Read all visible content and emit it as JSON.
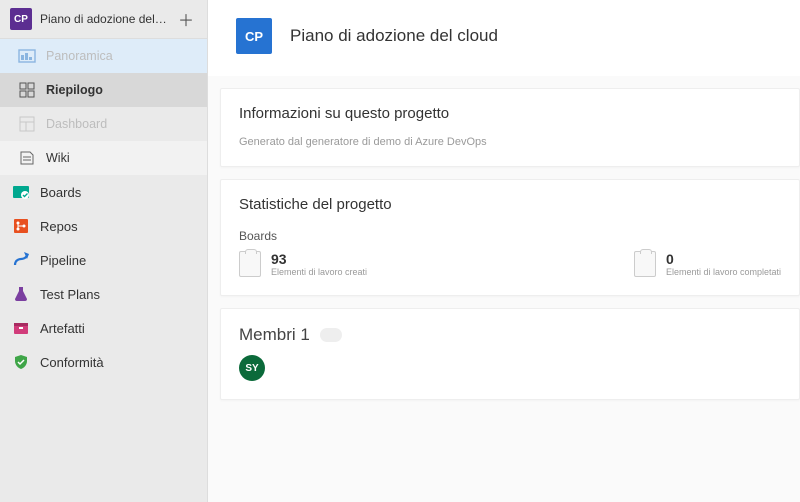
{
  "sidebar": {
    "project_badge": "CP",
    "project_name": "Piano di adozione del cloud",
    "items": [
      {
        "label": "Panoramica"
      },
      {
        "label": "Riepilogo"
      },
      {
        "label": "Dashboard"
      },
      {
        "label": "Wiki"
      },
      {
        "label": "Boards"
      },
      {
        "label": "Repos"
      },
      {
        "label": "Pipeline"
      },
      {
        "label": "Test Plans"
      },
      {
        "label": "Artefatti"
      },
      {
        "label": "Conformità"
      }
    ]
  },
  "header": {
    "badge": "CP",
    "title": "Piano di adozione del cloud"
  },
  "about": {
    "title": "Informazioni su questo progetto",
    "description": "Generato dal generatore di demo di Azure DevOps"
  },
  "stats": {
    "title": "Statistiche del progetto",
    "section_label": "Boards",
    "created": {
      "count": "93",
      "label": "Elementi di lavoro creati"
    },
    "completed": {
      "count": "0",
      "label": "Elementi di lavoro completati"
    }
  },
  "members": {
    "title": "Membri",
    "count": "1",
    "avatar": "SY"
  }
}
